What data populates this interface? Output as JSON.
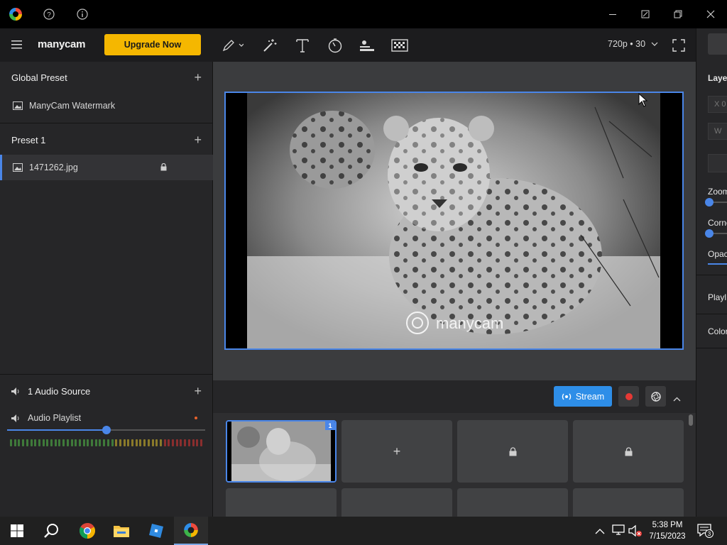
{
  "brand": {
    "name": "manycam",
    "upgrade_label": "Upgrade Now"
  },
  "resolution": {
    "label": "720p • 30"
  },
  "presets": {
    "global_title": "Global Preset",
    "global_items": [
      {
        "label": "ManyCam Watermark",
        "icon": "image-icon"
      }
    ],
    "preset1_title": "Preset 1",
    "preset1_items": [
      {
        "label": "1471262.jpg",
        "icon": "image-icon",
        "locked": true
      }
    ]
  },
  "audio": {
    "title": "1 Audio Source",
    "playlist_label": "Audio Playlist",
    "volume": 0.5
  },
  "stream": {
    "label": "Stream"
  },
  "grid": {
    "active_badge": "1",
    "tiles": [
      "image",
      "add",
      "locked",
      "locked"
    ]
  },
  "preview": {
    "watermark": "manycam"
  },
  "right_panel": {
    "tab": "Laye",
    "x_label": "X",
    "x_value": "0",
    "w_label": "W",
    "zoom_label": "Zoom",
    "corner_label": "Corne",
    "opacity_label": "Opac",
    "playlist_label": "Playl",
    "color_label": "Color"
  },
  "taskbar": {
    "time": "5:38 PM",
    "date": "7/15/2023",
    "notifications": "3"
  },
  "colors": {
    "accent": "#4a86e8",
    "upgrade": "#f5b700",
    "record": "#e53935"
  }
}
